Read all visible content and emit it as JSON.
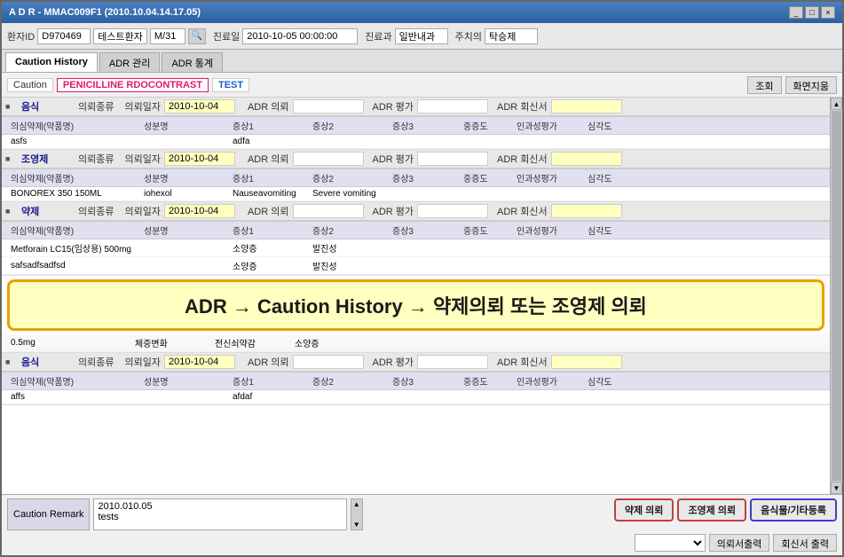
{
  "window": {
    "title": "A D R - MMAC009F1 (2010.10.04.14.17.05)",
    "controls": [
      "_",
      "□",
      "×"
    ]
  },
  "patient": {
    "id_label": "환자ID",
    "id_value": "D970469",
    "name_value": "테스트환자",
    "gender_age": "M/31",
    "visit_label": "진료일",
    "visit_value": "2010-10-05 00:00:00",
    "dept_label": "진료과",
    "dept_value": "일반내과",
    "doctor_label": "주치의",
    "doctor_value": "탁승제"
  },
  "tabs": [
    {
      "label": "Caution History",
      "active": true
    },
    {
      "label": "ADR 관리",
      "active": false
    },
    {
      "label": "ADR 통계",
      "active": false
    }
  ],
  "toolbar": {
    "pills": [
      {
        "label": "Caution",
        "type": "normal"
      },
      {
        "label": "PENICILLINE RDOCONTRAST",
        "type": "pink"
      },
      {
        "label": "TEST",
        "type": "blue"
      }
    ],
    "btn_search": "조회",
    "btn_screen": "화면지움"
  },
  "sections": [
    {
      "type": "음식",
      "date": "2010-10-04",
      "fields": [
        "",
        "",
        ""
      ],
      "sub_columns": [
        "의심약제(약품명)",
        "성분명",
        "증상1",
        "증상2",
        "증상3",
        "중증도",
        "인과성평가",
        "심각도"
      ],
      "rows": [
        {
          "drug": "asfs",
          "ingredient": "",
          "sym1": "adfa",
          "sym2": "",
          "sym3": "",
          "severity": "",
          "causal": "",
          "serious": ""
        }
      ]
    },
    {
      "type": "조영제",
      "date": "2010-10-04",
      "fields": [
        "",
        "",
        ""
      ],
      "sub_columns": [
        "의심약제(약품명)",
        "성분명",
        "증상1",
        "증상2",
        "증상3",
        "중증도",
        "인과성평가",
        "심각도"
      ],
      "rows": [
        {
          "drug": "BONOREX 350 150ML",
          "ingredient": "iohexol",
          "sym1": "Nauseavomiting",
          "sym2": "Severe vomiting",
          "sym3": "",
          "severity": "",
          "causal": "",
          "serious": ""
        }
      ]
    },
    {
      "type": "약제",
      "date": "2010-10-04",
      "fields": [
        "",
        "",
        ""
      ],
      "sub_columns": [
        "의심약제(약품명)",
        "성분명",
        "증상1",
        "증상2",
        "증상3",
        "중증도",
        "인과성평가",
        "심각도"
      ],
      "rows": [
        {
          "drug": "Metforain LC15(임상용) 500mg",
          "ingredient": "",
          "sym1": "소양증",
          "sym2": "발진성",
          "sym3": "",
          "severity": "",
          "causal": "",
          "serious": ""
        },
        {
          "drug": "safsadfsadfsd",
          "ingredient": "",
          "sym1": "소양증",
          "sym2": "발진성",
          "sym3": "",
          "severity": "",
          "causal": "",
          "serious": ""
        }
      ]
    }
  ],
  "highlight": {
    "text": "ADR  →  Caution History → 약제의뢰 또는 조영제 의뢰"
  },
  "extra_section": {
    "type": "음식",
    "date": "2010-10-04",
    "extra_fields": [
      "0.5mg",
      "",
      "체중변화",
      "전신쇠약감",
      "소양증"
    ],
    "sub_columns": [
      "의심약제(약품명)",
      "성분명",
      "증상1",
      "증상2",
      "증상3",
      "중증도",
      "인과성평가",
      "심각도"
    ],
    "rows": [
      {
        "drug": "affs",
        "ingredient": "",
        "sym1": "afdaf",
        "sym2": "",
        "sym3": "",
        "severity": "",
        "causal": "",
        "serious": ""
      }
    ]
  },
  "header_row_labels": {
    "type_label": "의뢰종류",
    "date_label": "의뢰일자",
    "adr_request": "ADR 의뢰",
    "adr_eval": "ADR 평가",
    "adr_callback": "ADR 회신서"
  },
  "bottom": {
    "remark_label": "Caution Remark",
    "remark_value": "2010.010.05\ntests",
    "btn_drug": "약제 의뢰",
    "btn_contrast": "조영제 의뢰",
    "btn_food": "음식물/기타등록",
    "btn_print_req": "의뢰서출력",
    "btn_print_cb": "회신서 출력",
    "dropdown_placeholder": ""
  }
}
